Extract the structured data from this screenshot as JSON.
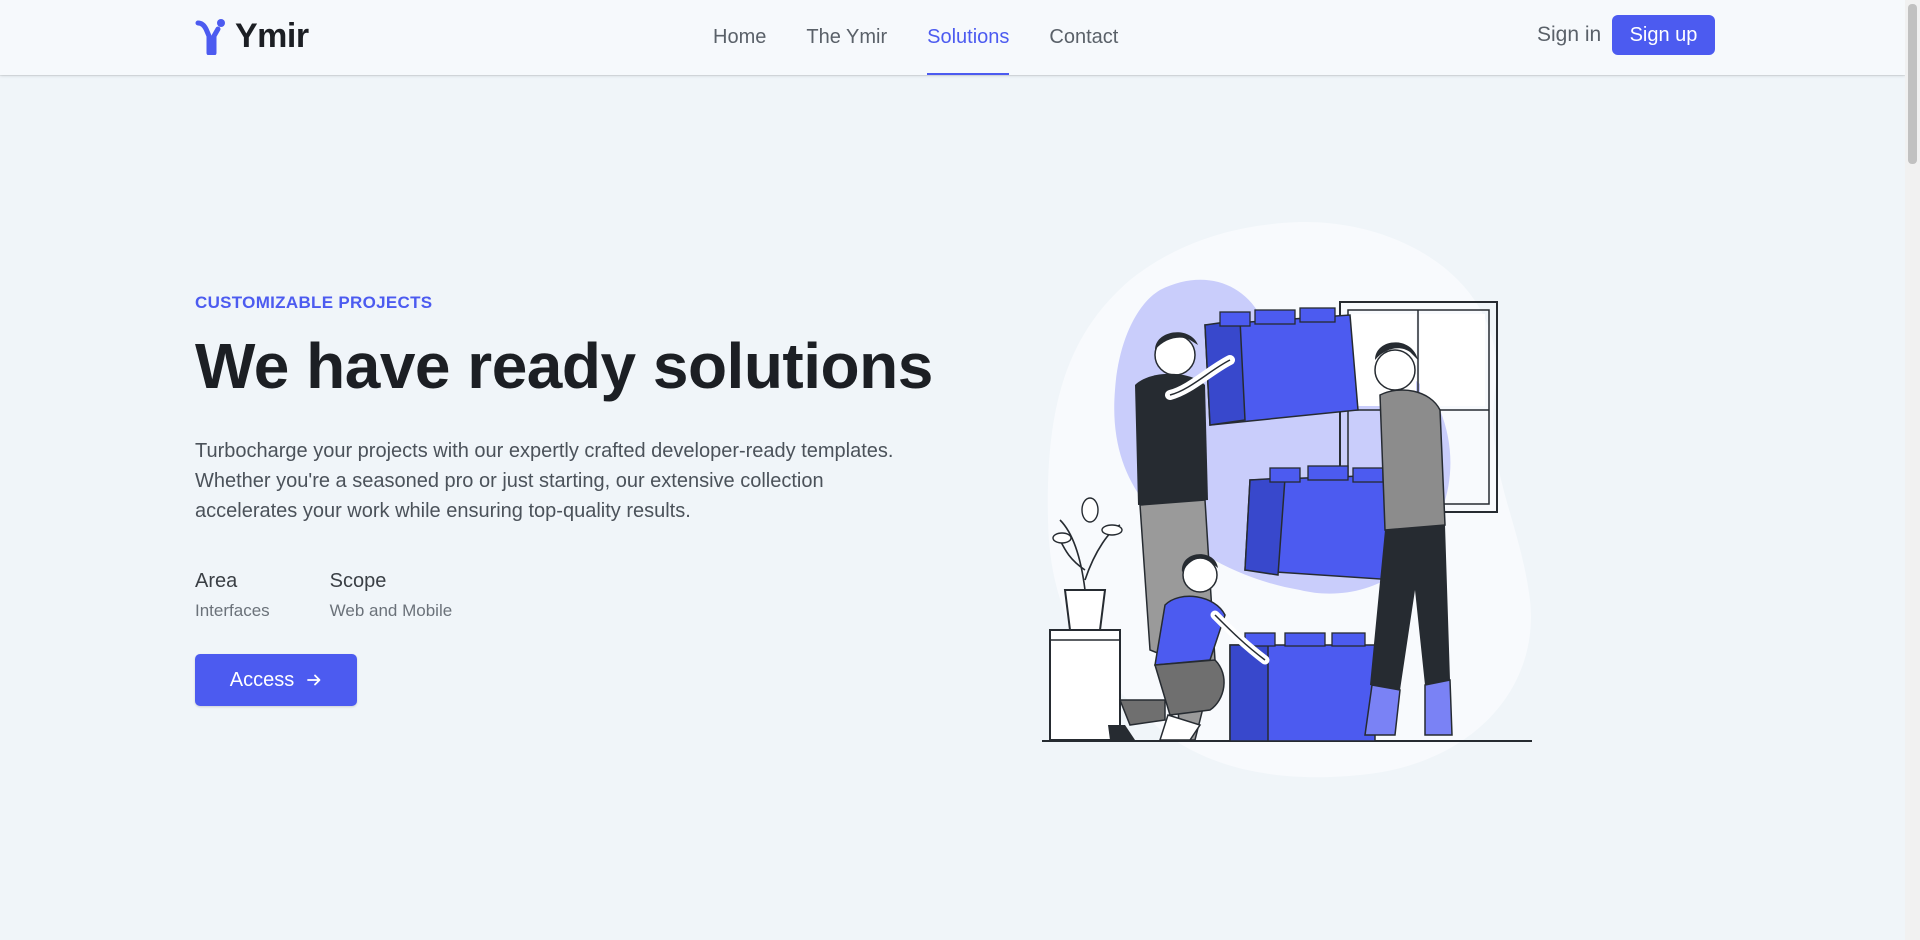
{
  "brand": {
    "name": "Ymir",
    "logo_icon": "ymir-logo-icon",
    "accent": "#4c5bf0"
  },
  "nav": {
    "items": [
      {
        "label": "Home",
        "active": false
      },
      {
        "label": "The Ymir",
        "active": false
      },
      {
        "label": "Solutions",
        "active": true
      },
      {
        "label": "Contact",
        "active": false
      }
    ],
    "sign_in": "Sign in",
    "sign_up": "Sign up"
  },
  "hero": {
    "eyebrow": "CUSTOMIZABLE PROJECTS",
    "title": "We have ready solutions",
    "description": "Turbocharge your projects with our expertly crafted developer-ready templates. Whether you're a seasoned pro or just starting, our extensive collection accelerates your work while ensuring top-quality results.",
    "meta": [
      {
        "label": "Area",
        "value": "Interfaces"
      },
      {
        "label": "Scope",
        "value": "Web and Mobile"
      }
    ],
    "cta_label": "Access",
    "cta_icon": "arrow-right-icon"
  },
  "illustration": {
    "icon": "team-building-blocks-illustration"
  }
}
